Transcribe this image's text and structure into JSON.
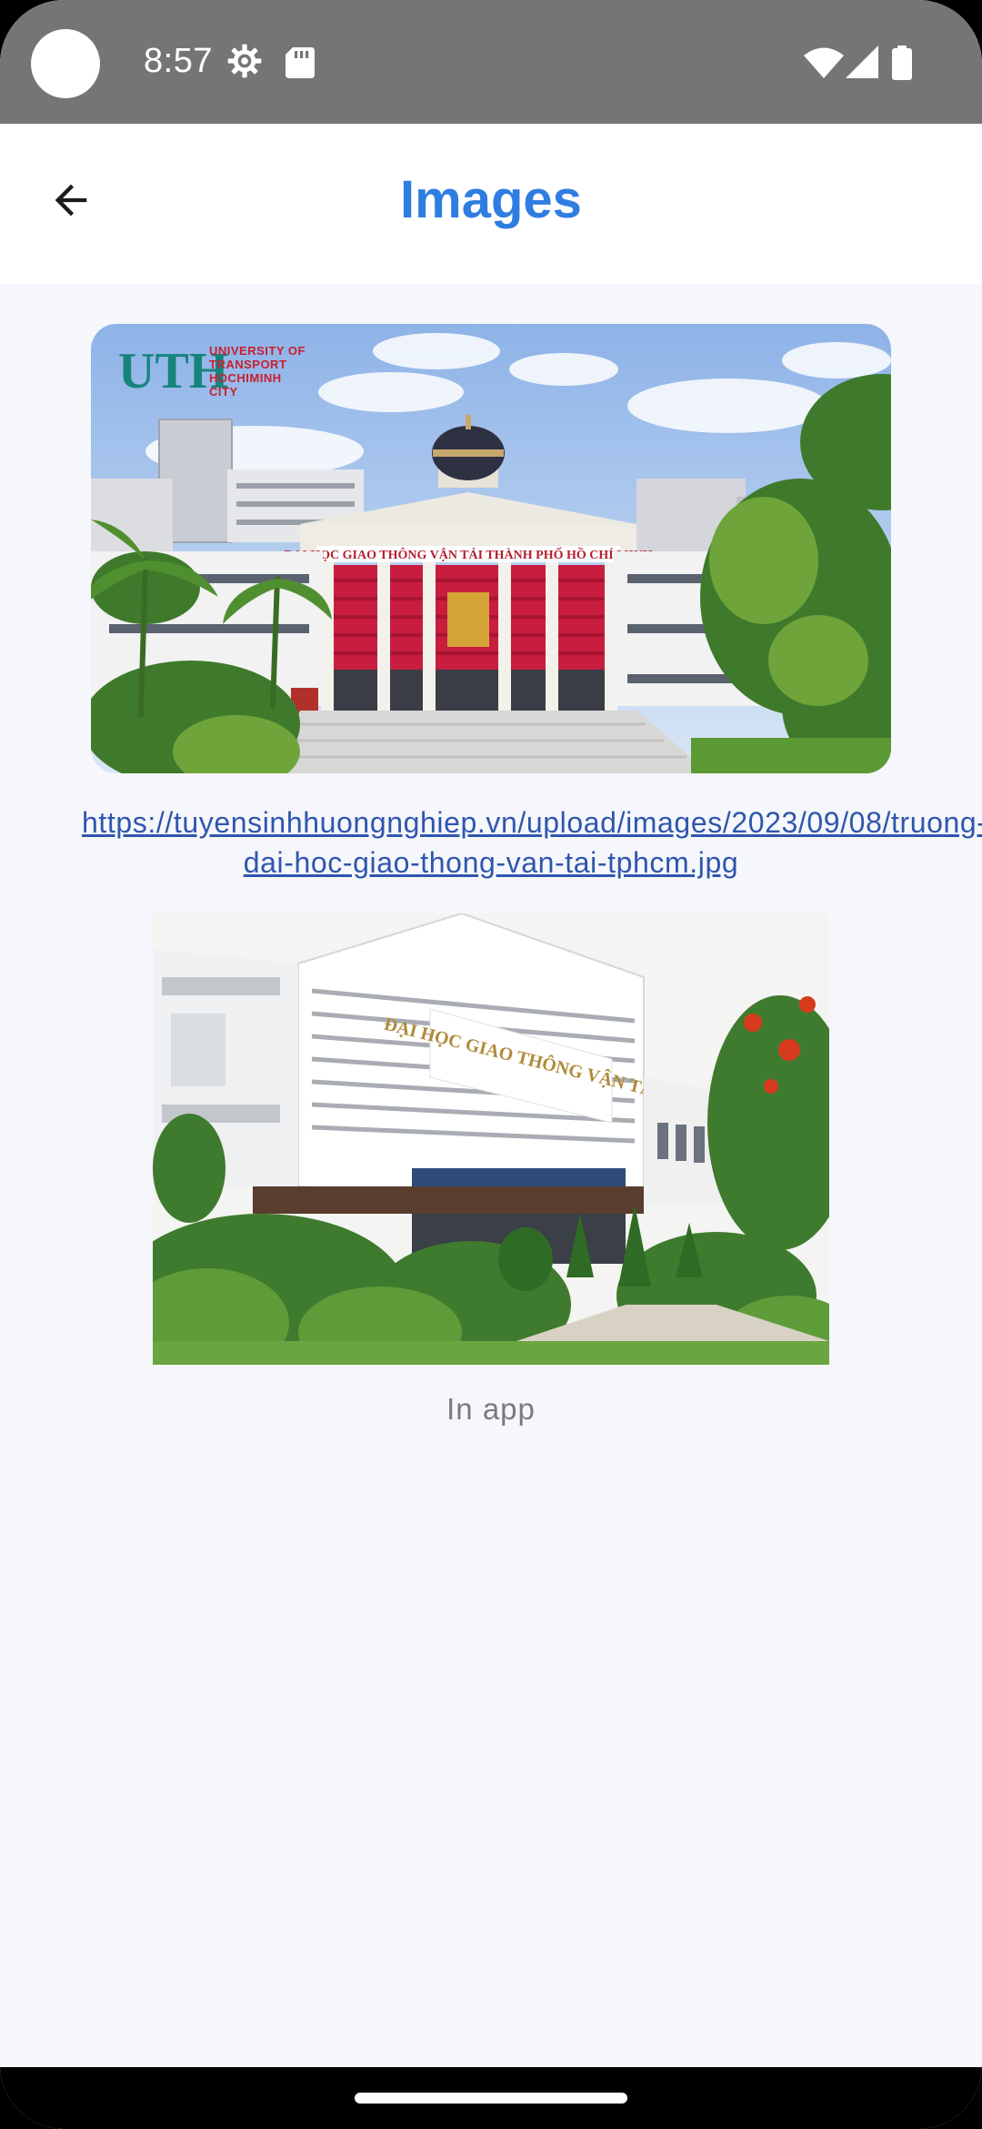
{
  "status_bar": {
    "time": "8:57",
    "icons_left": [
      "settings-gear-icon",
      "sd-card-icon"
    ],
    "icons_right": [
      "wifi-icon",
      "cell-signal-icon",
      "battery-icon"
    ]
  },
  "app_bar": {
    "title": "Images",
    "back_icon": "arrow-left-icon"
  },
  "images": [
    {
      "kind": "remote",
      "url_text": "https://tuyensinhhuongnghiep.vn/upload/images/2023/09/08/truong-dai-hoc-giao-thong-van-tai-tphcm.jpg",
      "logo_mark": "UTH",
      "logo_text": "UNIVERSITY OF TRANSPORT HOCHIMINH CITY",
      "facade_sign": "ĐẠI HỌC GIAO THÔNG VẬN TẢI THÀNH PHỐ HỒ CHÍ MINH"
    },
    {
      "kind": "local",
      "caption": "In app",
      "building_sign": "ĐẠI HỌC GIAO THÔNG VẬN TẢI"
    }
  ],
  "colors": {
    "title": "#2f7de1",
    "link": "#2f56ae",
    "status_bar": "#757575",
    "background": "#f6f7fc",
    "caption": "#7a7a7a"
  }
}
